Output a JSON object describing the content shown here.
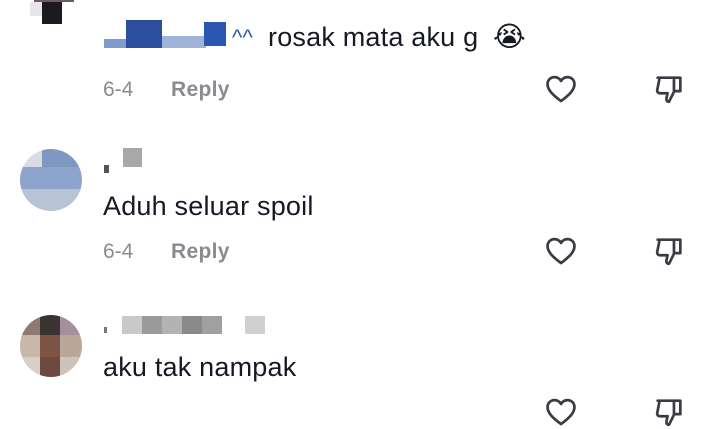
{
  "comments": [
    {
      "mention_suffix": "^^",
      "text": "rosak mata aku g",
      "emoji": "😭",
      "date": "6-4",
      "reply_label": "Reply",
      "like_icon": "heart-outline-icon",
      "dislike_icon": "thumbs-down-outline-icon"
    },
    {
      "text": "Aduh seluar spoil",
      "date": "6-4",
      "reply_label": "Reply",
      "like_icon": "heart-outline-icon",
      "dislike_icon": "thumbs-down-outline-icon"
    },
    {
      "text": "aku tak nampak",
      "like_icon": "heart-outline-icon",
      "dislike_icon": "thumbs-down-outline-icon"
    }
  ],
  "colors": {
    "text": "#161823",
    "meta": "#8a8b91",
    "mention": "#2b5aa8",
    "icon": "#3a3b44"
  }
}
